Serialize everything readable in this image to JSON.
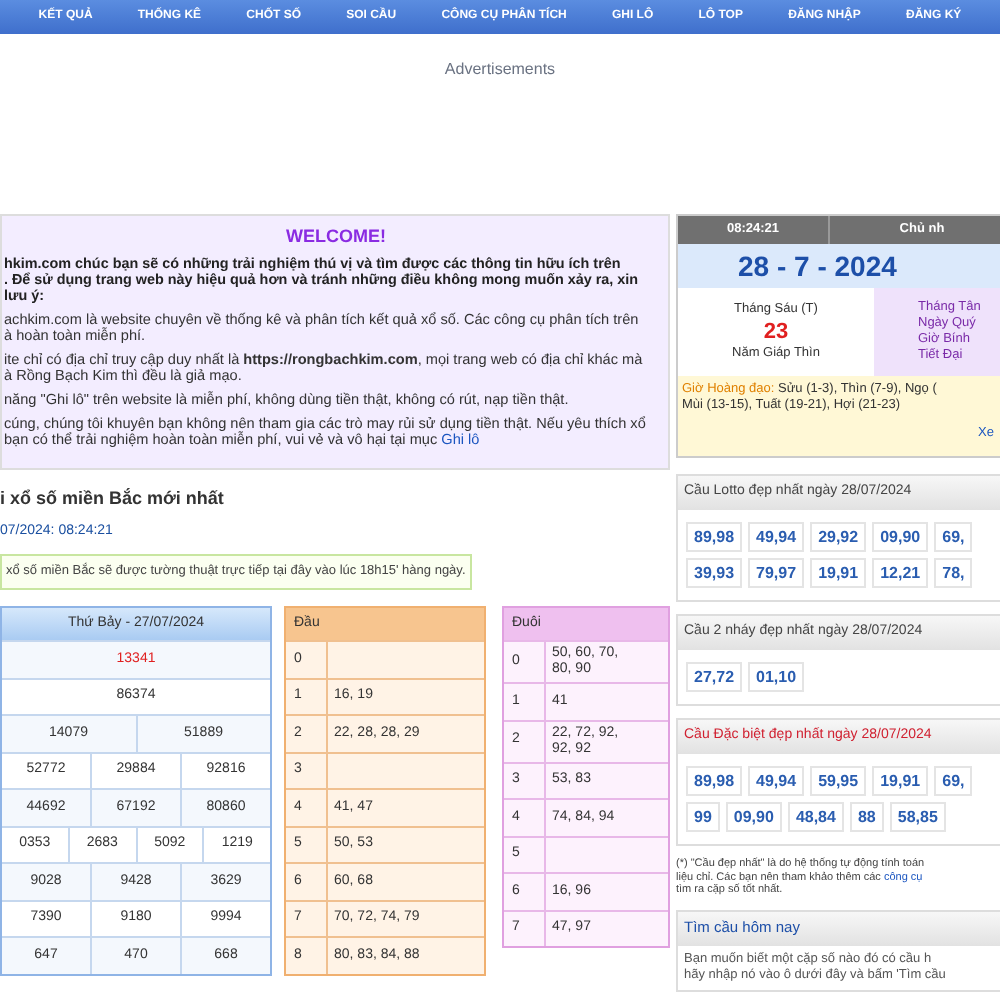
{
  "nav": [
    {
      "label": "KẾT QUẢ"
    },
    {
      "label": "THỐNG KÊ"
    },
    {
      "label": "CHỐT SỐ"
    },
    {
      "label": "SOI CẦU"
    },
    {
      "label": "CÔNG CỤ PHÂN TÍCH"
    },
    {
      "label": "GHI LÔ"
    },
    {
      "label": "LÔ TOP"
    },
    {
      "label": "ĐĂNG NHẬP"
    },
    {
      "label": "ĐĂNG KÝ"
    }
  ],
  "ad_label": "Advertisements",
  "welcome": {
    "title": "WELCOME!",
    "intro": [
      "hkim.com chúc bạn sẽ có những trải nghiệm thú vị và tìm được các thông tin hữu ích trên",
      ". Để sử dụng trang web này hiệu quả hơn và tránh những điều không mong muốn xảy ra, xin",
      "lưu ý:"
    ],
    "items": [
      {
        "lines": [
          "achkim.com là website chuyên về thống kê và phân tích kết quả xổ số. Các công cụ phân tích trên",
          "à hoàn toàn miễn phí."
        ]
      },
      {
        "lines": [
          "ite chỉ có địa chỉ truy cập duy nhất là **https://rongbachkim.com**, mọi trang web có địa chỉ khác mà",
          "à Rồng Bạch Kim thì đều là giả mạo."
        ]
      },
      {
        "lines": [
          "năng \"Ghi lô\" trên website là miễn phí, không dùng tiền thật, không có rút, nạp tiền thật."
        ]
      },
      {
        "lines": [
          "cúng, chúng tôi khuyên bạn không nên tham gia các trò may rủi sử dụng tiền thật. Nếu yêu thích xổ",
          "bạn có thể trải nghiệm hoàn toàn miễn phí, vui vẻ và vô hại tại mục"
        ],
        "link": "Ghi lô"
      }
    ]
  },
  "latest": {
    "title": "i xổ số miền Bắc mới nhất",
    "updated": "07/2024: 08:24:21",
    "notice": "xổ số miền Bắc sẽ được tường thuật trực tiếp tại đây vào lúc 18h15' hàng ngày."
  },
  "results": {
    "header": "Thứ Bảy - 27/07/2024",
    "rows": [
      {
        "numbers": [
          "13341"
        ],
        "special": true
      },
      {
        "numbers": [
          "86374"
        ],
        "special": false
      },
      {
        "numbers": [
          "14079",
          "51889"
        ],
        "special": false
      },
      {
        "numbers": [
          "52772",
          "29884",
          "92816"
        ],
        "special": false
      },
      {
        "numbers": [
          "44692",
          "67192",
          "80860"
        ],
        "special": false
      },
      {
        "numbers": [
          "0353",
          "2683",
          "5092",
          "1219"
        ],
        "special": false
      },
      {
        "numbers": [
          "9028",
          "9428",
          "3629"
        ],
        "special": false
      },
      {
        "numbers": [
          "7390",
          "9180",
          "9994"
        ],
        "special": false
      },
      {
        "numbers": [
          "647",
          "470",
          "668"
        ],
        "special": false
      }
    ]
  },
  "head_table": {
    "header": "Đầu",
    "rows": [
      {
        "digit": "0"
      },
      {
        "digit": "1",
        "values": "16, 19"
      },
      {
        "digit": "2",
        "values": "22, 28, 28, 29"
      },
      {
        "digit": "3"
      },
      {
        "digit": "4",
        "values": "41, 47"
      },
      {
        "digit": "5",
        "values": "50, 53"
      },
      {
        "digit": "6",
        "values": "60, 68"
      },
      {
        "digit": "7",
        "values": "70, 72, 74, 79"
      },
      {
        "digit": "8",
        "values": "80, 83, 84, 88"
      }
    ]
  },
  "tail_table": {
    "header": "Đuôi",
    "rows": [
      {
        "digit": "0",
        "values": "50, 60, 70, 80, 90"
      },
      {
        "digit": "1",
        "values": "41"
      },
      {
        "digit": "2",
        "values": "22, 72, 92, 92, 92"
      },
      {
        "digit": "3",
        "values": "53, 83"
      },
      {
        "digit": "4",
        "values": "74, 84, 94"
      },
      {
        "digit": "5"
      },
      {
        "digit": "6",
        "values": "16, 96"
      },
      {
        "digit": "7",
        "values": "47, 97"
      }
    ]
  },
  "clock": {
    "time": "08:24:21",
    "weekday": "Chủ nh",
    "date": "28 - 7 - 2024",
    "lunar_month": "Tháng Sáu (T)",
    "lunar_day": "23",
    "lunar_year": "Năm Giáp Thìn",
    "lunar_details": [
      "Tháng Tân",
      "Ngày Quý",
      "Giờ Bính",
      "Tiết Đại"
    ],
    "good_hours_label": "Giờ Hoàng đạo:",
    "good_hours": [
      "Sửu (1-3), Thìn (7-9), Ngọ (",
      "Mùi (13-15), Tuất (19-21), Hợi (21-23)"
    ],
    "more": "Xe"
  },
  "pair_cards": [
    {
      "title": "Cầu Lotto đẹp nhất ngày 28/07/2024",
      "kind": "normal",
      "rows": [
        [
          "89,98",
          "49,94",
          "29,92",
          "09,90",
          "69,"
        ],
        [
          "39,93",
          "79,97",
          "19,91",
          "12,21",
          "78,"
        ]
      ]
    },
    {
      "title": "Cầu 2 nháy đẹp nhất ngày 28/07/2024",
      "kind": "normal",
      "rows": [
        [
          "27,72",
          "01,10"
        ]
      ]
    },
    {
      "title": "Cầu Đặc biệt đẹp nhất ngày 28/07/2024",
      "kind": "special",
      "rows": [
        [
          "89,98",
          "49,94",
          "59,95",
          "19,91",
          "69,"
        ],
        [
          "99",
          "09,90",
          "48,84",
          "88",
          "58,85"
        ]
      ]
    }
  ],
  "note": [
    {
      "text": "(*) \"Cầu đẹp nhất\" là do hệ thống tự động tính toán"
    },
    {
      "text": "liệu chỉ. Các bạn nên tham khảo thêm các",
      "link": "công cụ"
    },
    {
      "text": "tìm ra cặp số tốt nhất."
    }
  ],
  "find": {
    "title": "Tìm cầu hôm nay",
    "lines": [
      "Bạn muốn biết một cặp số nào đó có cầu h",
      "hãy nhập nó vào ô dưới đây và bấm 'Tìm cầu"
    ]
  }
}
